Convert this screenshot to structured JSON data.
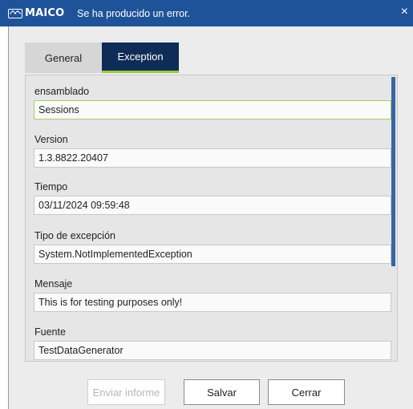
{
  "window": {
    "logo_text": "MAICO",
    "title": "Se ha producido un error.",
    "close_glyph": "×"
  },
  "tabs": [
    {
      "label": "General",
      "selected": false
    },
    {
      "label": "Exception",
      "selected": true
    }
  ],
  "fields": [
    {
      "label": "ensamblado",
      "value": "Sessions"
    },
    {
      "label": "Version",
      "value": "1.3.8822.20407"
    },
    {
      "label": "Tiempo",
      "value": "03/11/2024 09:59:48"
    },
    {
      "label": "Tipo de excepción",
      "value": "System.NotImplementedException"
    },
    {
      "label": "Mensaje",
      "value": "This is for testing purposes only!"
    },
    {
      "label": "Fuente",
      "value": "TestDataGenerator"
    }
  ],
  "buttons": {
    "send": "Enviar informe",
    "save": "Salvar",
    "close": "Cerrar"
  },
  "colors": {
    "titlebar": "#1f5399",
    "tab_selected": "#0f2b57",
    "tab_accent": "#9ac63b",
    "scrollbar": "#3566a6"
  }
}
